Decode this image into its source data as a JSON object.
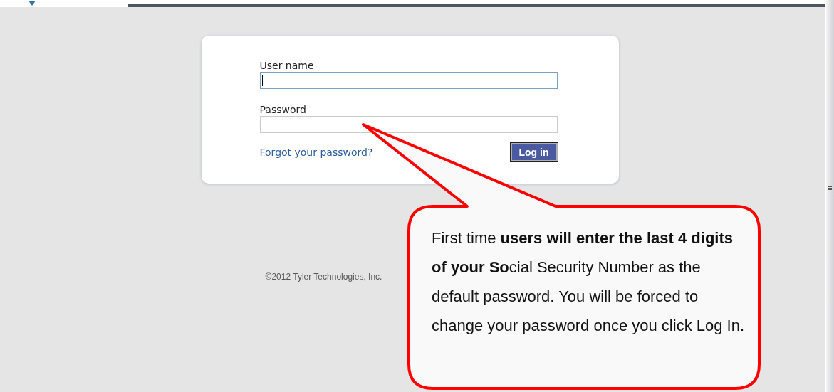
{
  "login": {
    "fields": [
      {
        "label": "User name",
        "focused": true
      },
      {
        "label": "Password",
        "focused": false
      }
    ],
    "forgot_link": "Forgot your password?",
    "login_button": "Log in"
  },
  "footer": {
    "copyright": "©2012 Tyler Technologies, Inc."
  },
  "callout": {
    "text": "First time **users will enter the last 4 digits of your So**cial Security Number as the default password. You will be forced to change your password once you click Log In."
  }
}
